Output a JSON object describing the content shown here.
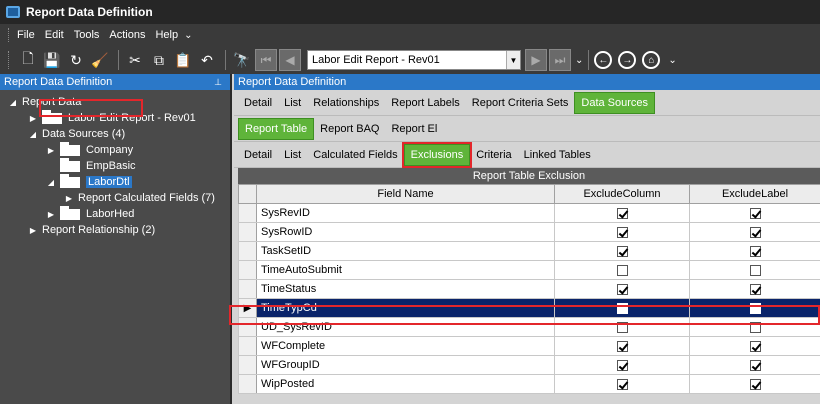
{
  "window": {
    "title": "Report Data Definition"
  },
  "menu": {
    "items": [
      "File",
      "Edit",
      "Tools",
      "Actions",
      "Help"
    ],
    "more": "⌄"
  },
  "toolbar": {
    "combo_value": "Labor Edit Report - Rev01"
  },
  "left_panel": {
    "title": "Report Data Definition",
    "pin": "📌",
    "tree": [
      {
        "label": "Report Data",
        "level": 0,
        "arrow": "◢"
      },
      {
        "label": "Labor Edit Report - Rev01",
        "level": 1,
        "arrow": "▶",
        "folder": true
      },
      {
        "label": "Data Sources (4)",
        "level": 1,
        "arrow": "◢"
      },
      {
        "label": "Company",
        "level": 2,
        "arrow": "▶",
        "folder": true
      },
      {
        "label": "EmpBasic",
        "level": 2,
        "arrow": "",
        "folder": true
      },
      {
        "label": "LaborDtl",
        "level": 2,
        "arrow": "◢",
        "folder": true,
        "selected": true
      },
      {
        "label": "Report Calculated Fields (7)",
        "level": 3,
        "arrow": "▶"
      },
      {
        "label": "LaborHed",
        "level": 2,
        "arrow": "▶",
        "folder": true
      },
      {
        "label": "Report Relationship (2)",
        "level": 0,
        "arrow": "▶"
      }
    ]
  },
  "right_panel": {
    "title": "Report Data Definition",
    "tabs1": [
      "Detail",
      "List",
      "Relationships",
      "Report Labels",
      "Report Criteria Sets",
      "Data Sources"
    ],
    "tabs2": [
      "Report Table",
      "Report BAQ",
      "Report El"
    ],
    "tabs3": [
      "Detail",
      "List",
      "Calculated Fields",
      "Exclusions",
      "Criteria",
      "Linked Tables"
    ],
    "grid": {
      "title": "Report Table Exclusion",
      "columns": [
        "Field Name",
        "ExcludeColumn",
        "ExcludeLabel"
      ],
      "rows": [
        {
          "field": "SysRevID",
          "col": true,
          "label": true
        },
        {
          "field": "SysRowID",
          "col": true,
          "label": true
        },
        {
          "field": "TaskSetID",
          "col": true,
          "label": true
        },
        {
          "field": "TimeAutoSubmit",
          "col": false,
          "label": false
        },
        {
          "field": "TimeStatus",
          "col": true,
          "label": true
        },
        {
          "field": "TimeTypCd",
          "col": false,
          "label": false,
          "current": true
        },
        {
          "field": "UD_SysRevID",
          "col": false,
          "label": false
        },
        {
          "field": "WFComplete",
          "col": true,
          "label": true
        },
        {
          "field": "WFGroupID",
          "col": true,
          "label": true
        },
        {
          "field": "WipPosted",
          "col": true,
          "label": true
        }
      ]
    }
  },
  "colors": {
    "accent": "#2b78c8",
    "active_tab": "#5fb43a",
    "highlight": "#e3262b",
    "selected_row": "#0a246a"
  }
}
